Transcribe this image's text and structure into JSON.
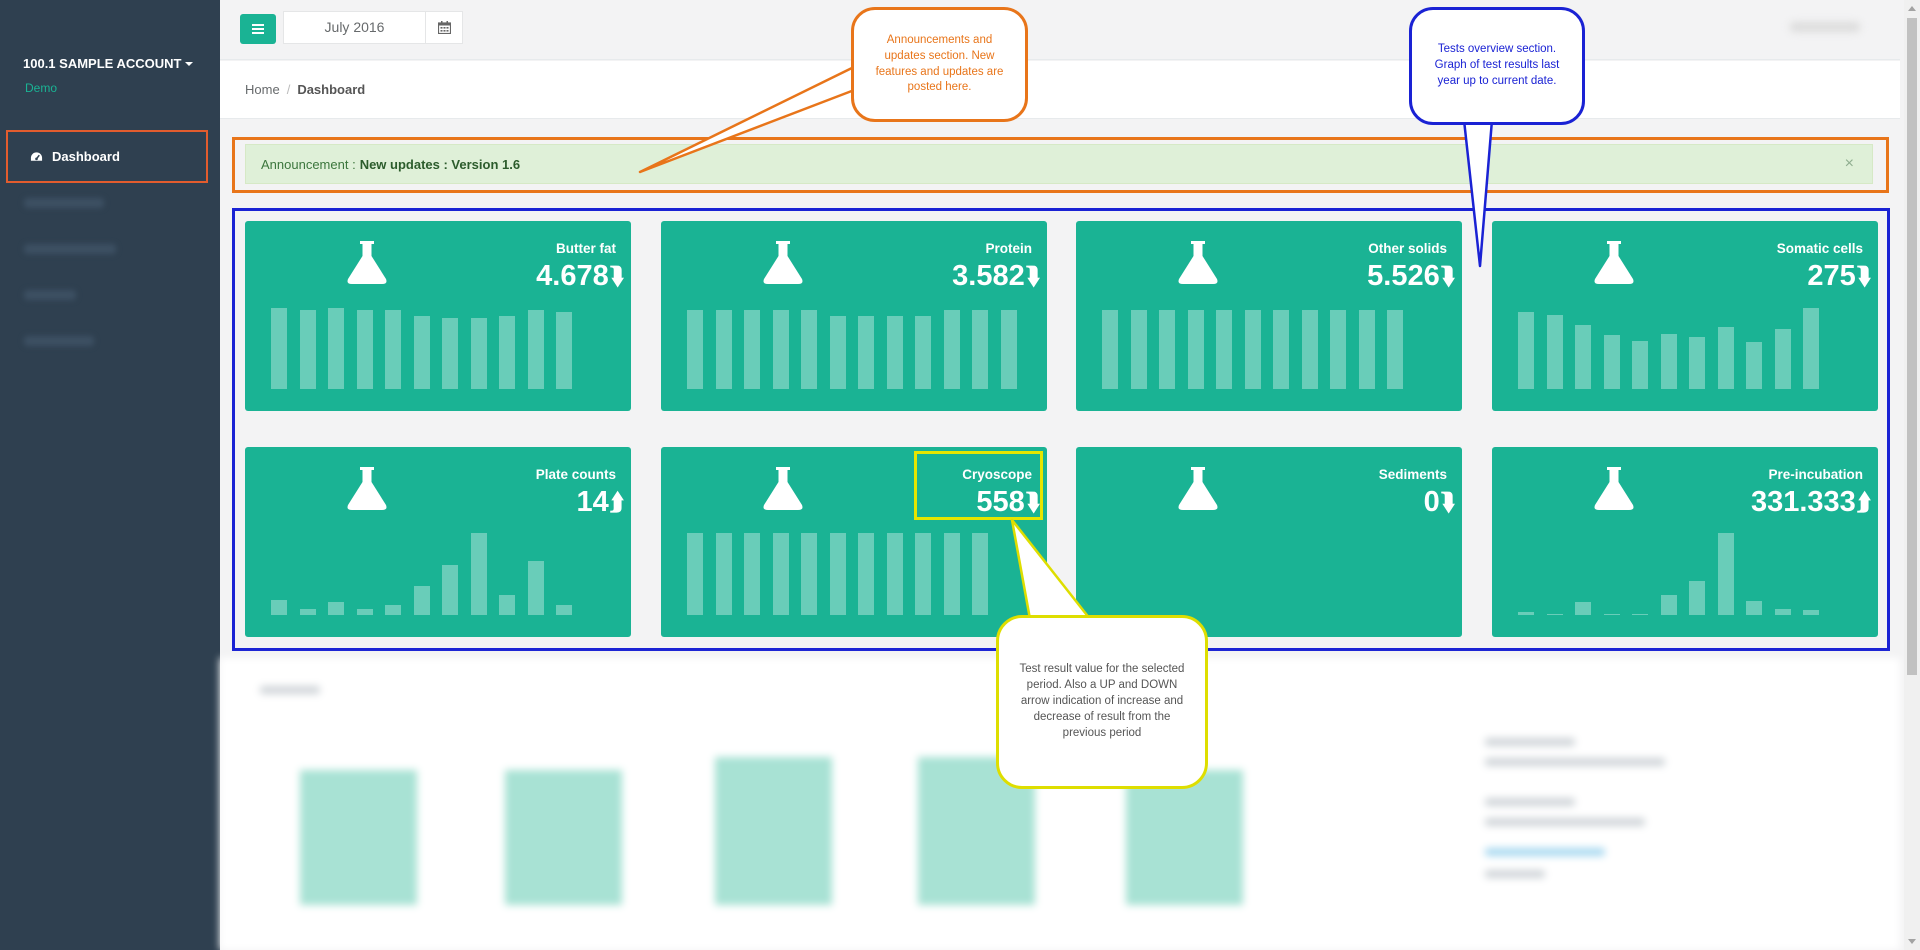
{
  "sidebar": {
    "account_name": "100.1 SAMPLE ACCOUNT",
    "account_sub": "Demo",
    "active_item": "Dashboard"
  },
  "topbar": {
    "date": "July 2016"
  },
  "breadcrumb": {
    "home": "Home",
    "separator": "/",
    "current": "Dashboard"
  },
  "announcement": {
    "label": "Announcement :",
    "text": "New updates : Version 1.6",
    "close": "×"
  },
  "cards": [
    {
      "title": "Butter fat",
      "value": "4.678",
      "trend": "down",
      "arrow": "⮯",
      "bar_levels": [
        0.64,
        0.63,
        0.64,
        0.63,
        0.63,
        0.58,
        0.56,
        0.56,
        0.58,
        0.63,
        0.61
      ]
    },
    {
      "title": "Protein",
      "value": "3.582",
      "trend": "down",
      "arrow": "⮯",
      "bar_levels": [
        0.63,
        0.63,
        0.63,
        0.63,
        0.63,
        0.58,
        0.58,
        0.58,
        0.58,
        0.63,
        0.63,
        0.63
      ]
    },
    {
      "title": "Other solids",
      "value": "5.526",
      "trend": "down",
      "arrow": "⮯",
      "bar_levels": [
        0.63,
        0.63,
        0.63,
        0.63,
        0.63,
        0.63,
        0.63,
        0.63,
        0.63,
        0.63,
        0.63
      ]
    },
    {
      "title": "Somatic cells",
      "value": "275",
      "trend": "down",
      "arrow": "⮯",
      "bar_levels": [
        0.61,
        0.59,
        0.51,
        0.43,
        0.38,
        0.44,
        0.41,
        0.49,
        0.37,
        0.48,
        0.64
      ]
    },
    {
      "title": "Plate counts",
      "value": "14",
      "trend": "up",
      "arrow": "⮭",
      "bar_levels": [
        0.12,
        0.05,
        0.1,
        0.05,
        0.08,
        0.23,
        0.4,
        0.65,
        0.16,
        0.43,
        0.08
      ]
    },
    {
      "title": "Cryoscope",
      "value": "558",
      "trend": "down",
      "arrow": "⮯",
      "bar_levels": [
        0.65,
        0.65,
        0.65,
        0.65,
        0.65,
        0.65,
        0.65,
        0.65,
        0.65,
        0.65,
        0.65
      ]
    },
    {
      "title": "Sediments",
      "value": "0",
      "trend": "down",
      "arrow": "⮯",
      "bar_levels": []
    },
    {
      "title": "Pre-incubation",
      "value": "331.333",
      "trend": "up",
      "arrow": "⮭",
      "bar_levels": [
        0.02,
        0.01,
        0.1,
        0.01,
        0.01,
        0.16,
        0.27,
        0.65,
        0.11,
        0.05,
        0.04
      ]
    }
  ],
  "callouts": {
    "announcements": "Announcements and updates section. New features and updates are posted here.",
    "tests": "Tests overview section. Graph of test results last year up to current date.",
    "value": "Test result value for the selected period. Also a UP and DOWN arrow indication of increase and decrease of result from the previous period"
  },
  "icons": [
    "hamburger-icon",
    "calendar-icon",
    "dashboard-icon",
    "flask-icon",
    "close-icon"
  ],
  "colors": {
    "brand": "#1ab394",
    "sidebar": "#2f4050",
    "callout_orange": "#e8751a",
    "callout_blue": "#1a22d4",
    "callout_yellow": "#dede00"
  }
}
